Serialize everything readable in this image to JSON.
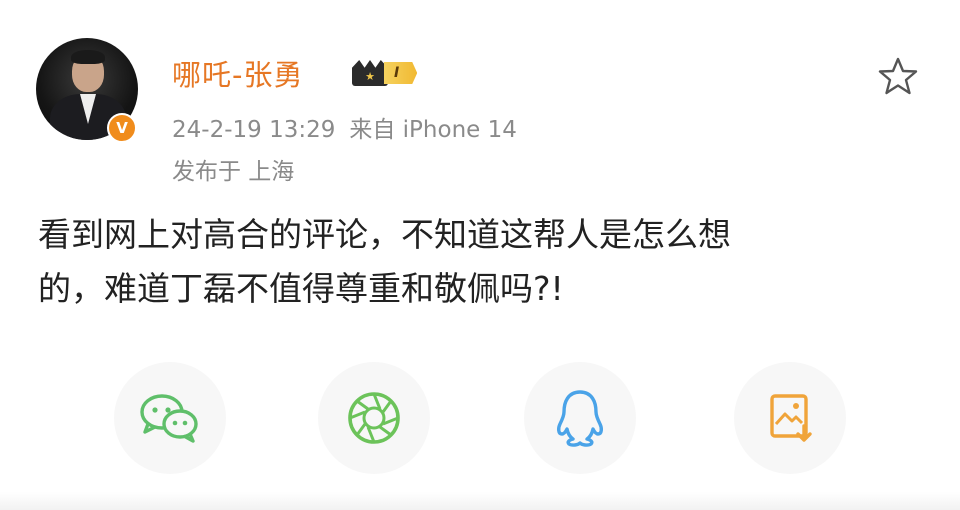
{
  "post": {
    "author": {
      "name": "哪吒-张勇",
      "verified_label": "V",
      "level_label": "I"
    },
    "date_time": "24-2-19 13:29",
    "source": "来自 iPhone 14",
    "location": "发布于 上海",
    "text_line1": "看到网上对高合的评论，不知道这帮人是怎么想",
    "text_line2": "的，难道丁磊不值得尊重和敬佩吗?!"
  },
  "share": {
    "items": [
      {
        "icon": "wechat-icon",
        "color": "#5fbf6a"
      },
      {
        "icon": "moments-icon",
        "color": "#6cc35a"
      },
      {
        "icon": "qq-icon",
        "color": "#4aa3e8"
      },
      {
        "icon": "save-image-icon",
        "color": "#f0a43a"
      }
    ]
  },
  "colors": {
    "username": "#e67724",
    "meta": "#8a8a8a",
    "text": "#222222",
    "verified": "#f08c1c"
  }
}
